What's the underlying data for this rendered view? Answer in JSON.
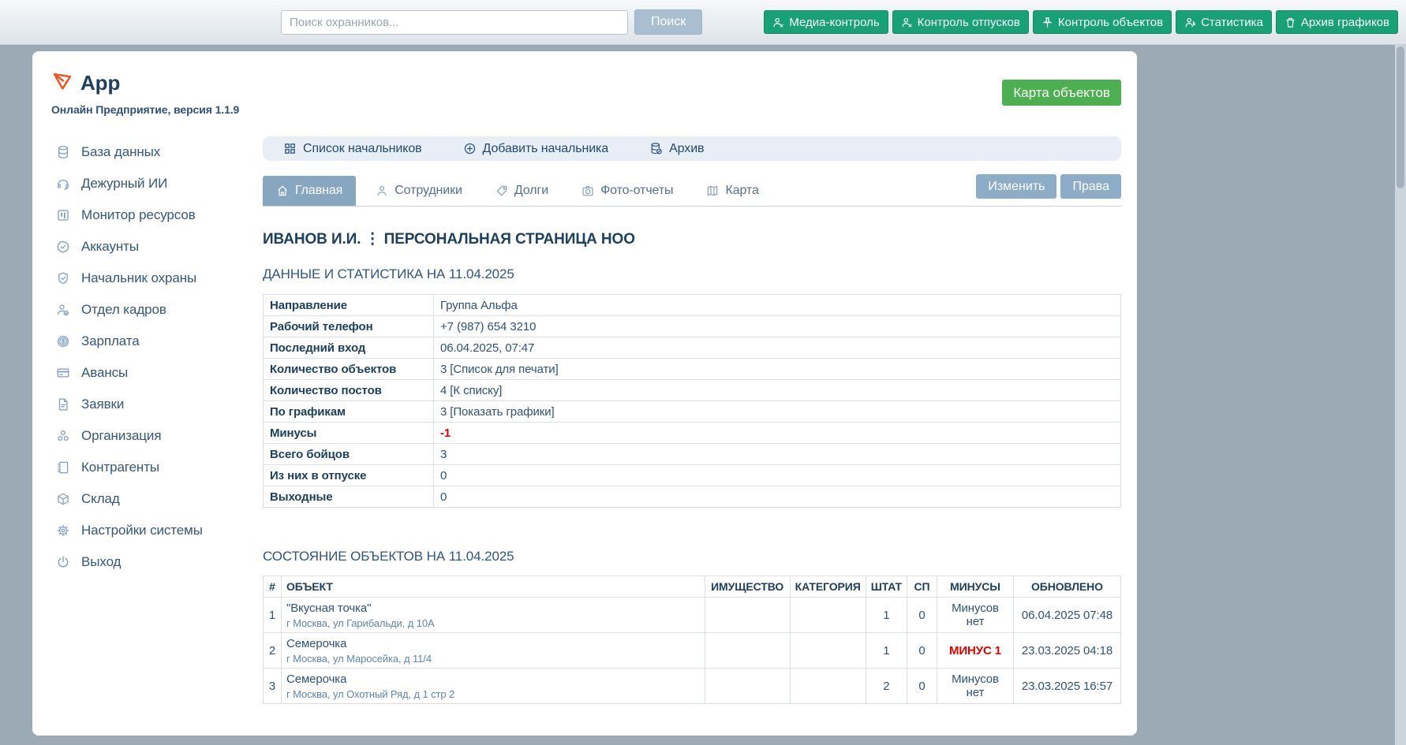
{
  "topbar": {
    "search_placeholder": "Поиск охранников...",
    "search_button": "Поиск",
    "buttons": [
      {
        "label": "Медиа-контроль",
        "icon": "person-icon"
      },
      {
        "label": "Контроль отпусков",
        "icon": "person-icon"
      },
      {
        "label": "Контроль объектов",
        "icon": "pin-icon"
      },
      {
        "label": "Статистика",
        "icon": "person-icon"
      },
      {
        "label": "Архив графиков",
        "icon": "trash-icon"
      }
    ]
  },
  "branding": {
    "app_name": "App",
    "subtitle": "Онлайн Предприятие, версия 1.1.9",
    "logo_color": "#f4511e"
  },
  "sidebar": {
    "items": [
      {
        "label": "База данных",
        "icon": "database-icon"
      },
      {
        "label": "Дежурный ИИ",
        "icon": "headset-icon"
      },
      {
        "label": "Монитор ресурсов",
        "icon": "board-icon"
      },
      {
        "label": "Аккаунты",
        "icon": "badge-check-icon"
      },
      {
        "label": "Начальник охраны",
        "icon": "shield-check-icon"
      },
      {
        "label": "Отдел кадров",
        "icon": "person-check-icon"
      },
      {
        "label": "Зарплата",
        "icon": "dollar-coin-icon"
      },
      {
        "label": "Авансы",
        "icon": "credit-card-icon"
      },
      {
        "label": "Заявки",
        "icon": "document-icon"
      },
      {
        "label": "Организация",
        "icon": "boxes-icon"
      },
      {
        "label": "Контрагенты",
        "icon": "notebook-icon"
      },
      {
        "label": "Склад",
        "icon": "package-icon"
      },
      {
        "label": "Настройки системы",
        "icon": "gear-icon"
      },
      {
        "label": "Выход",
        "icon": "power-icon"
      }
    ]
  },
  "map_button": "Карта объектов",
  "toolbar": {
    "items": [
      {
        "label": "Список начальников",
        "icon": "grid-icon"
      },
      {
        "label": "Добавить начальника",
        "icon": "plus-circle-icon"
      },
      {
        "label": "Архив",
        "icon": "database-archive-icon"
      }
    ]
  },
  "tabs": {
    "items": [
      {
        "label": "Главная",
        "icon": "home-icon",
        "active": true
      },
      {
        "label": "Сотрудники",
        "icon": "person-icon",
        "active": false
      },
      {
        "label": "Долги",
        "icon": "tag-icon",
        "active": false
      },
      {
        "label": "Фото-отчеты",
        "icon": "camera-icon",
        "active": false
      },
      {
        "label": "Карта",
        "icon": "map-icon",
        "active": false
      }
    ],
    "actions": [
      {
        "label": "Изменить"
      },
      {
        "label": "Права"
      }
    ]
  },
  "page": {
    "title": "ИВАНОВ И.И. ⋮ ПЕРСОНАЛЬНАЯ СТРАНИЦА НОО"
  },
  "stats": {
    "heading": "ДАННЫЕ И СТАТИСТИКА НА 11.04.2025",
    "rows": [
      {
        "label": "Направление",
        "value": "Группа Альфа"
      },
      {
        "label": "Рабочий телефон",
        "value": "+7 (987) 654 3210"
      },
      {
        "label": "Последний вход",
        "value": "06.04.2025, 07:47"
      },
      {
        "label": "Количество объектов",
        "value": "3 [Список для печати]"
      },
      {
        "label": "Количество постов",
        "value": "4 [К списку]"
      },
      {
        "label": "По графикам",
        "value": "3 [Показать графики]"
      },
      {
        "label": "Минусы",
        "value": "-1",
        "highlight": "red"
      },
      {
        "label": "Всего бойцов",
        "value": "3"
      },
      {
        "label": "Из них в отпуске",
        "value": "0"
      },
      {
        "label": "Выходные",
        "value": "0"
      }
    ]
  },
  "objects": {
    "heading": "СОСТОЯНИЕ ОБЪЕКТОВ НА 11.04.2025",
    "columns": [
      "#",
      "ОБЪЕКТ",
      "ИМУЩЕСТВО",
      "КАТЕГОРИЯ",
      "ШТАТ",
      "СП",
      "МИНУСЫ",
      "ОБНОВЛЕНО"
    ],
    "rows": [
      {
        "num": "1",
        "name": "\"Вкусная точка\"",
        "address": "г Москва, ул Гарибальди, д 10А",
        "property": "",
        "category": "",
        "staff": "1",
        "sp": "0",
        "minus": "Минусов нет",
        "minus_red": false,
        "updated": "06.04.2025 07:48"
      },
      {
        "num": "2",
        "name": "Семерочка",
        "address": "г Москва, ул Маросейка, д 11/4",
        "property": "",
        "category": "",
        "staff": "1",
        "sp": "0",
        "minus": "МИНУС 1",
        "minus_red": true,
        "updated": "23.03.2025 04:18"
      },
      {
        "num": "3",
        "name": "Семерочка",
        "address": "г Москва, ул Охотный Ряд, д 1 стр 2",
        "property": "",
        "category": "",
        "staff": "2",
        "sp": "0",
        "minus": "Минусов нет",
        "minus_red": false,
        "updated": "23.03.2025 16:57"
      }
    ]
  },
  "colors": {
    "topbar_button_green": "#18a174",
    "map_button_green": "#4caf50",
    "action_blue": "#8cacc7",
    "alert_red": "#e60000"
  }
}
